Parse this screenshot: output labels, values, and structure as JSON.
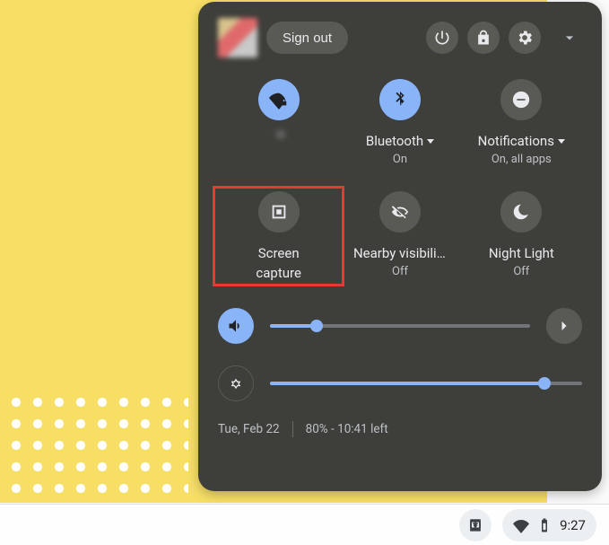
{
  "header": {
    "signout_label": "Sign out"
  },
  "tiles": {
    "network": {
      "label": "",
      "sub": ""
    },
    "bluetooth": {
      "label": "Bluetooth",
      "sub": "On"
    },
    "notifications": {
      "label": "Notifications",
      "sub": "On, all apps"
    },
    "screencap": {
      "label1": "Screen",
      "label2": "capture"
    },
    "nearby": {
      "label": "Nearby visibility",
      "sub": "Off"
    },
    "nightlight": {
      "label": "Night Light",
      "sub": "Off"
    }
  },
  "sliders": {
    "volume_percent": 18,
    "brightness_percent": 88
  },
  "footer": {
    "date": "Tue, Feb 22",
    "battery_status": "80% - 10:41 left"
  },
  "taskbar": {
    "clock": "9:27"
  },
  "icons": {
    "power": "power-icon",
    "lock": "lock-icon",
    "settings": "gear-icon",
    "collapse": "chevron-down-icon",
    "wifi": "wifi-lock-icon",
    "bluetooth": "bluetooth-icon",
    "dnd": "do-not-disturb-icon",
    "screencap": "screen-capture-icon",
    "visibility_off": "visibility-off-icon",
    "nightlight": "night-light-icon",
    "volume": "volume-icon",
    "brightness": "brightness-icon",
    "audio_next": "chevron-right-icon",
    "download": "download-tray-icon",
    "tray_wifi": "wifi-icon",
    "tray_battery": "battery-icon"
  },
  "colors": {
    "panel_bg": "#3e3e3a",
    "accent": "#8ab4f8",
    "highlight": "#e53935",
    "desktop": "#f7df66"
  }
}
